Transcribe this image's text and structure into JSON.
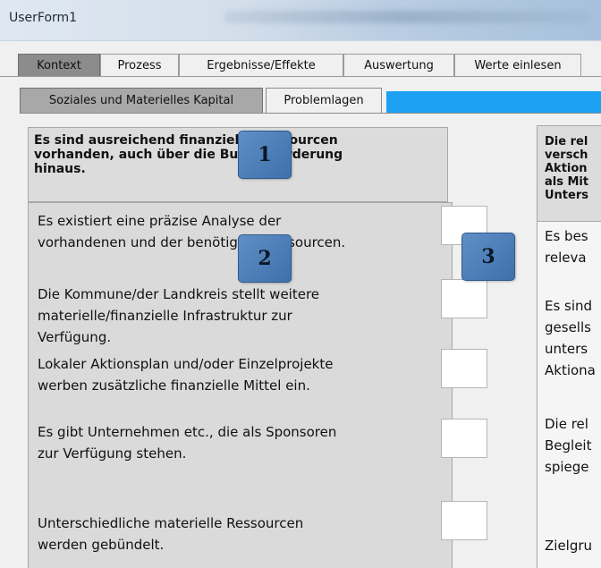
{
  "window": {
    "title": "UserForm1"
  },
  "main_tabs": [
    {
      "label": "Kontext",
      "active": true
    },
    {
      "label": "Prozess",
      "active": false
    },
    {
      "label": "Ergebnisse/Effekte",
      "active": false
    },
    {
      "label": "Auswertung",
      "active": false
    },
    {
      "label": "Werte einlesen",
      "active": false
    }
  ],
  "sub_tabs": [
    {
      "label": "Soziales und Materielles Kapital",
      "active": true
    },
    {
      "label": "Problemlagen",
      "active": false
    }
  ],
  "section_header": {
    "lines": [
      "Es sind ausreichend finanzielle Ressourcen",
      "vorhanden, auch über die Bundesförderung",
      "hinaus."
    ]
  },
  "items": [
    {
      "lines": [
        "Es existiert eine präzise Analyse der",
        "vorhandenen und der benötigten Ressourcen."
      ],
      "checked": false
    },
    {
      "lines": [
        "Die Kommune/der Landkreis stellt weitere",
        "materielle/finanzielle Infrastruktur zur",
        "Verfügung."
      ],
      "checked": false
    },
    {
      "lines": [
        "Lokaler Aktionsplan und/oder Einzelprojekte",
        "werben zusätzliche finanzielle Mittel ein."
      ],
      "checked": false
    },
    {
      "lines": [
        "Es gibt Unternehmen etc., die als Sponsoren",
        "zur Verfügung stehen."
      ],
      "checked": false
    },
    {
      "lines": [
        "Unterschiedliche materielle Ressourcen",
        "werden gebündelt."
      ],
      "checked": false
    }
  ],
  "right_header": {
    "lines": [
      "Die rel",
      "versch",
      "Aktion",
      "als Mit",
      "Unters"
    ]
  },
  "right_items": [
    {
      "lines": [
        "Es bes",
        "releva"
      ]
    },
    {
      "lines": [
        "Es sind",
        "gesells",
        "unters",
        "Aktiona"
      ]
    },
    {
      "lines": [
        "Die rel",
        "Begleit",
        "spiege"
      ]
    },
    {
      "lines": [
        "Zielgru"
      ]
    }
  ],
  "badges": [
    "1",
    "2",
    "3"
  ],
  "colors": {
    "accent_strip": "#1da1f2",
    "badge": "#4a7bb7"
  }
}
